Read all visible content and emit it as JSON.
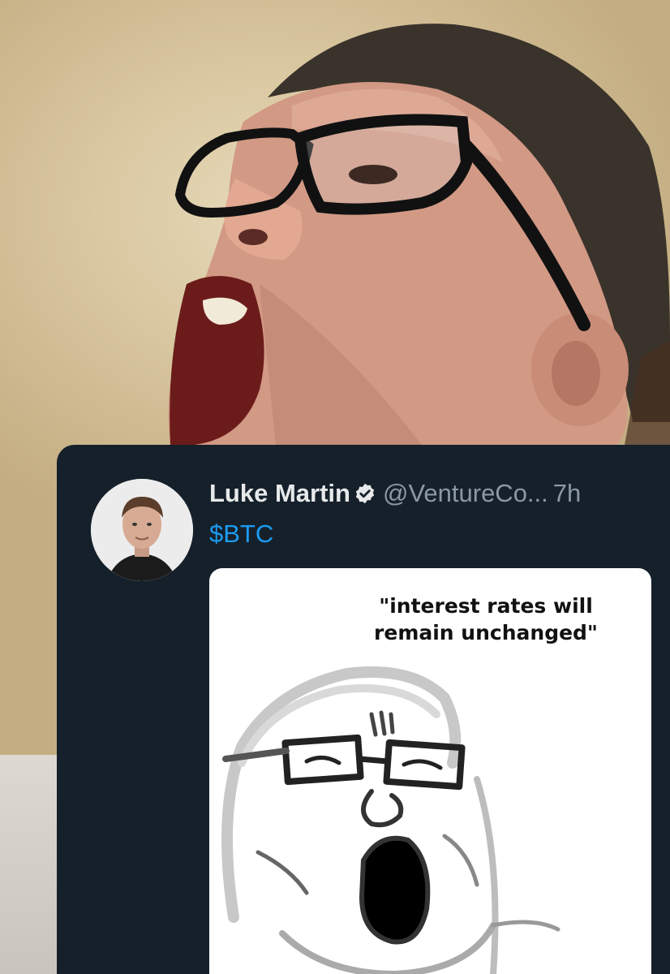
{
  "tweet": {
    "display_name": "Luke Martin",
    "handle": "@VentureCo...",
    "time": "7h",
    "text": "$BTC",
    "verified": true,
    "colors": {
      "card_bg": "#15202b",
      "name": "#e7e9ea",
      "muted": "#8b98a5",
      "link": "#1d9bf0"
    }
  },
  "media": {
    "caption": "\"interest rates will remain unchanged\""
  },
  "icons": {
    "verified": "verified-badge-icon",
    "avatar": "avatar"
  }
}
